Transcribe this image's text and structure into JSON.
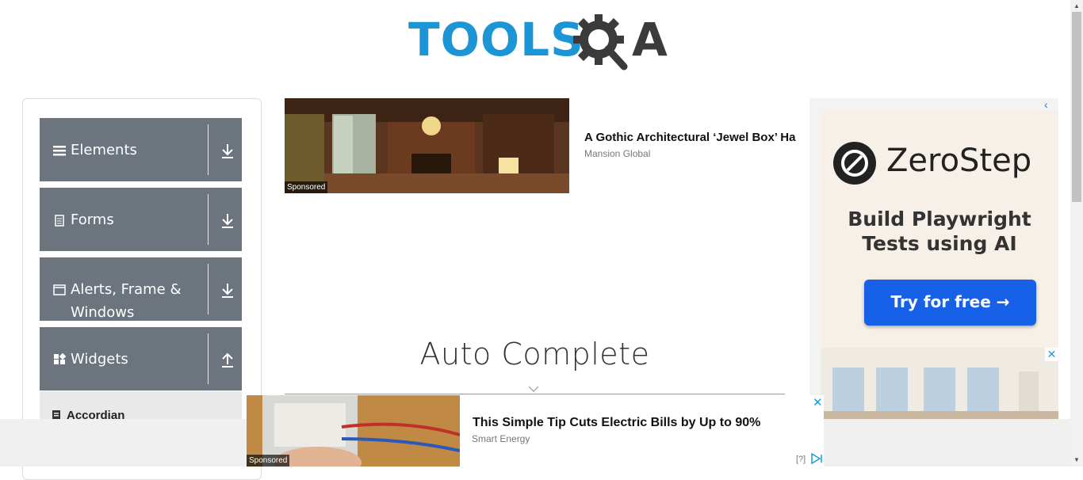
{
  "header": {
    "logo_text_tools": "TOOLS",
    "logo_text_a": "A",
    "brand_color": "#1b95d5"
  },
  "sidebar": {
    "groups": [
      {
        "label": "Elements",
        "icon": "hamburger-icon",
        "arrow": "download-arrow-icon"
      },
      {
        "label": "Forms",
        "icon": "document-icon",
        "arrow": "download-arrow-icon"
      },
      {
        "label": "Alerts, Frame & Windows",
        "icon": "window-icon",
        "arrow": "download-arrow-icon"
      },
      {
        "label": "Widgets",
        "icon": "widgets-icon",
        "arrow": "upload-arrow-icon"
      }
    ],
    "sub_items": [
      {
        "label": "Accordian",
        "icon": "document-icon"
      }
    ],
    "group_color": "#6c757d"
  },
  "ads": {
    "top": {
      "sponsored": "Sponsored",
      "title": "A Gothic Architectural ‘Jewel Box’ Ha",
      "source": "Mansion Global"
    },
    "right": {
      "brand": "ZeroStep",
      "tagline": "Build Playwright Tests using AI",
      "cta": "Try for free →",
      "back": "‹",
      "close": "✕"
    },
    "bottom": {
      "sponsored": "Sponsored",
      "title": "This Simple Tip Cuts Electric Bills by Up to 90%",
      "source": "Smart Energy",
      "close": "✕",
      "info": "[?]"
    }
  },
  "main": {
    "title": "Auto Complete"
  }
}
